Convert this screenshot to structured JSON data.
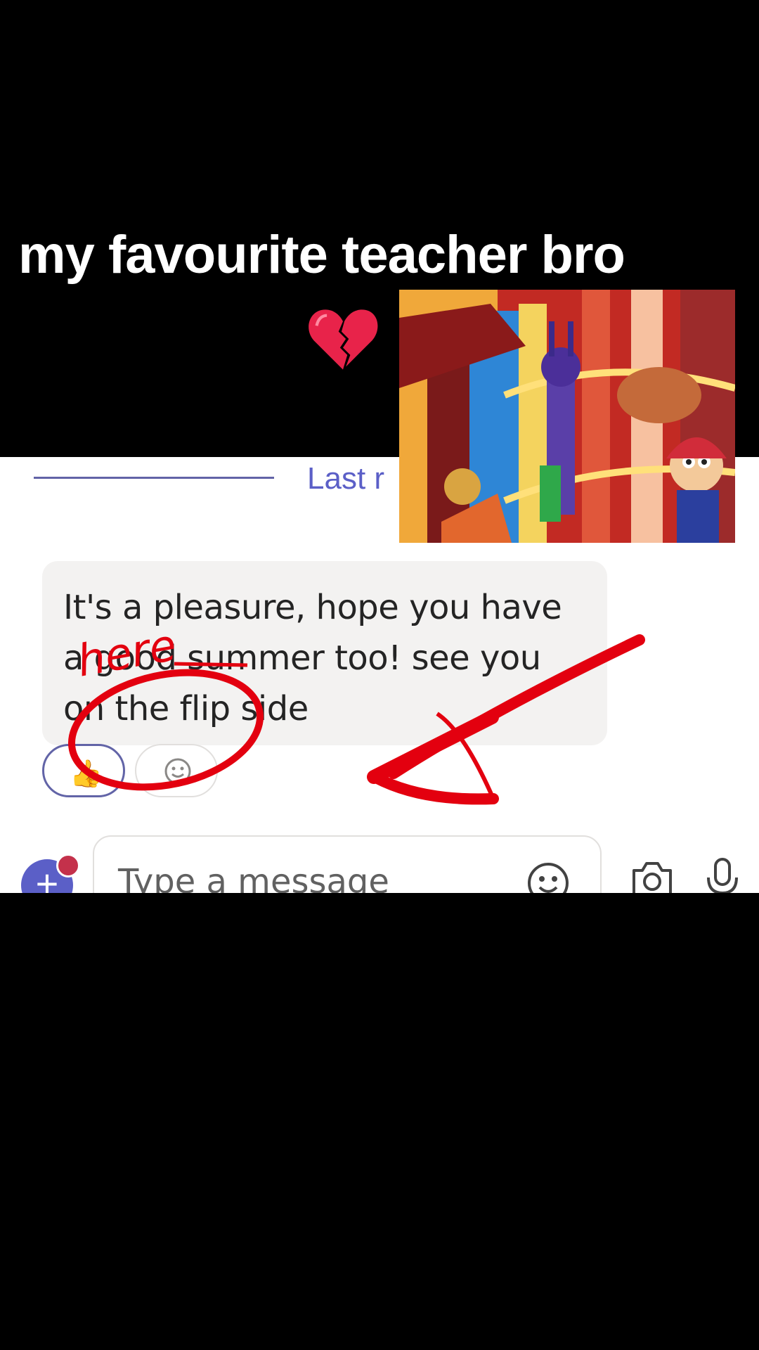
{
  "caption": {
    "text": "my favourite teacher bro",
    "emoji": "broken-heart-emoji"
  },
  "chat": {
    "last_read_label": "Last r",
    "message": {
      "line1": "It's a pleasure, hope you have",
      "line2": "a good summer too! see you",
      "line3": "on the flip side"
    },
    "reactions": [
      {
        "icon": "thumbs-up-emoji",
        "glyph": "👍",
        "selected": true
      },
      {
        "icon": "add-reaction-icon",
        "glyph": "",
        "selected": false
      }
    ],
    "compose": {
      "placeholder": "Type a message",
      "plus_icon": "plus-icon",
      "emoji_icon": "smiley-icon",
      "camera_icon": "camera-icon",
      "mic_icon": "microphone-icon"
    }
  },
  "overlay": {
    "annotation_text": "here",
    "annotation_color": "#e3000f",
    "video_thumbnail": "cartoon-circus-scene"
  },
  "colors": {
    "accent": "#5b5fc7",
    "bubble": "#f3f2f1",
    "notification": "#c4314b"
  }
}
